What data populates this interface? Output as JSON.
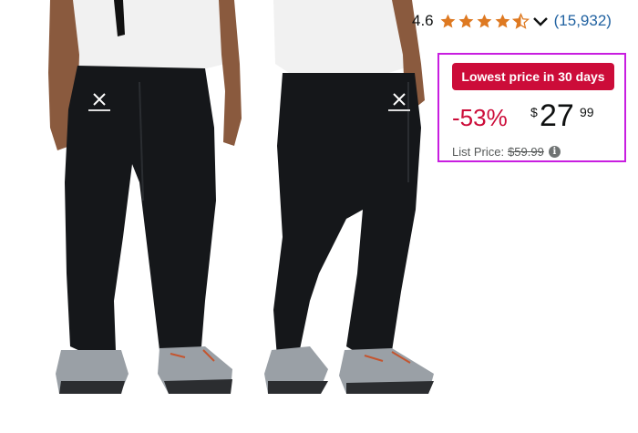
{
  "rating": {
    "value": "4.6",
    "stars": 4.5,
    "count": "(15,932)",
    "star_color": "#de7921"
  },
  "deal": {
    "badge": "Lowest price in 30 days",
    "badge_color": "#cc0c39",
    "highlight_border_color": "#c81ee0",
    "discount": "-53%",
    "price_symbol": "$",
    "price_whole": "27",
    "price_fraction": "99",
    "list_price_label": "List Price:",
    "list_price_value": "$59.99",
    "info_icon_glyph": "i"
  },
  "product_images": [
    {
      "view": "front",
      "icon": "joggers-front-photo"
    },
    {
      "view": "side",
      "icon": "joggers-side-photo"
    }
  ]
}
